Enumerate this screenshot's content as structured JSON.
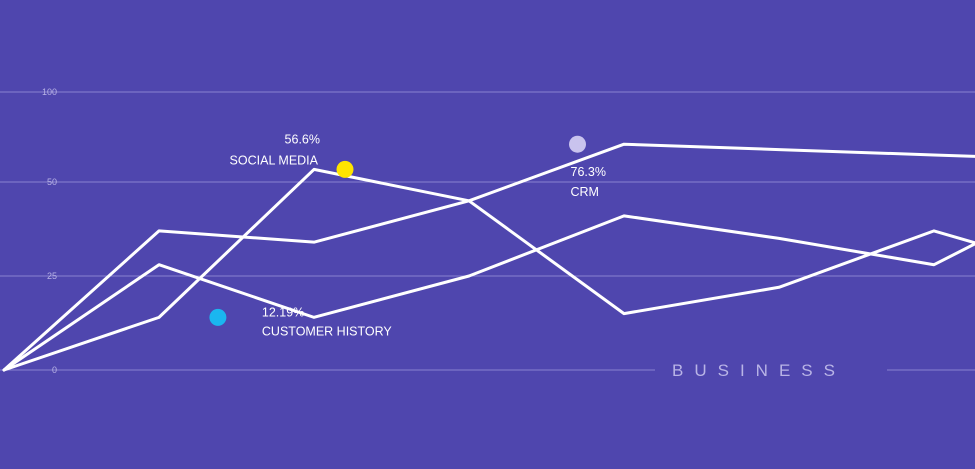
{
  "chart_data": {
    "type": "line",
    "ylim": [
      0,
      100
    ],
    "yticks": [
      0,
      25,
      50,
      100
    ],
    "grid": true,
    "axis_word": "BUSINESS",
    "x": [
      0,
      1,
      2,
      3,
      4,
      5,
      6,
      7
    ],
    "series": [
      {
        "values": [
          0,
          37,
          34,
          45,
          71,
          68,
          65,
          62
        ]
      },
      {
        "values": [
          0,
          28,
          14,
          25,
          41,
          35,
          28,
          49
        ]
      },
      {
        "values": [
          0,
          14,
          57,
          45,
          15,
          22,
          37,
          25
        ]
      }
    ],
    "annotations": [
      {
        "value": "56.6%",
        "label": "SOCIAL MEDIA",
        "x": 2.2,
        "y": 57,
        "color": "#ffe400"
      },
      {
        "value": "12.19%",
        "label": "CUSTOMER HISTORY",
        "x": 1.38,
        "y": 14,
        "color": "#1ab6f0"
      },
      {
        "value": "76.3%",
        "label": "CRM",
        "x": 3.7,
        "y": 71,
        "color": "#c9c3ee"
      }
    ]
  }
}
